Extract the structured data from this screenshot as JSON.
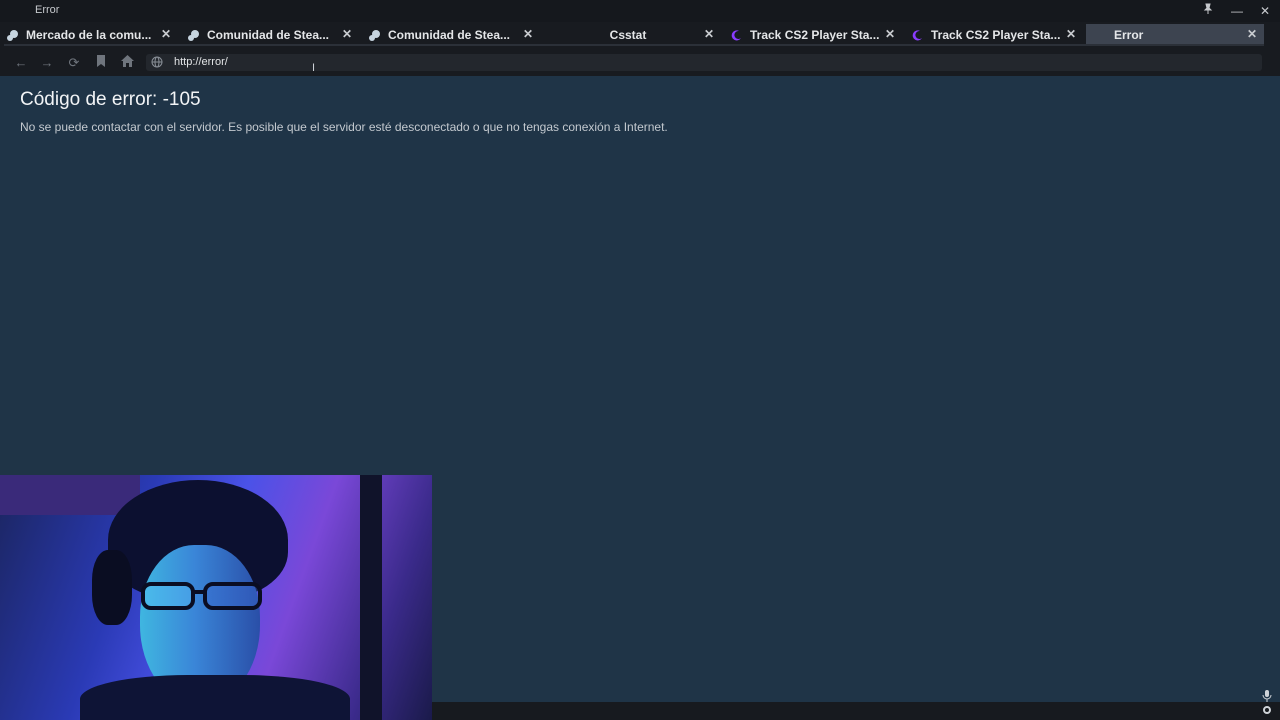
{
  "window": {
    "title": "Error"
  },
  "tabs": [
    {
      "label": "Mercado de la comu...",
      "icon": "steam-icon"
    },
    {
      "label": "Comunidad de Stea...",
      "icon": "steam-icon"
    },
    {
      "label": "Comunidad de Stea...",
      "icon": "steam-icon"
    },
    {
      "label": "Csstat",
      "icon": ""
    },
    {
      "label": "Track CS2 Player Sta...",
      "icon": "leetify-icon"
    },
    {
      "label": "Track CS2 Player Sta...",
      "icon": "leetify-icon"
    },
    {
      "label": "Error",
      "icon": "",
      "active": true
    }
  ],
  "nav": {
    "url": "http://error/"
  },
  "page": {
    "error_title": "Código de error: -105",
    "error_message": "No se puede contactar con el servidor. Es posible que el servidor esté desconectado o que no tengas conexión a Internet."
  },
  "colors": {
    "content_bg": "#1f3447",
    "chrome_bg": "#181b20",
    "active_tab": "#3d4450"
  }
}
